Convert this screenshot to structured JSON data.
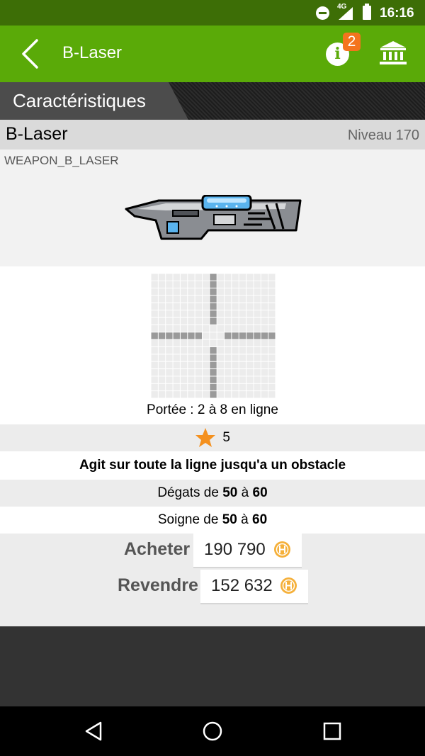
{
  "status_bar": {
    "network": "4G",
    "time": "16:16",
    "icons": [
      "do-not-disturb-icon",
      "signal-icon",
      "battery-icon"
    ]
  },
  "app_bar": {
    "title": "B-Laser",
    "notification_count": "2",
    "icons": [
      "back-arrow-icon",
      "info-icon",
      "bank-icon"
    ]
  },
  "section": {
    "title": "Caractéristiques"
  },
  "item": {
    "name": "B-Laser",
    "level": "Niveau 170",
    "code": "WEAPON_B_LASER",
    "range_text": "Portée : 2 à 8 en ligne",
    "cost": "5",
    "effect": "Agit sur toute la ligne jusqu'a un obstacle",
    "damage": {
      "prefix": "Dégats de",
      "min": "50",
      "sep": "à",
      "max": "60"
    },
    "heal": {
      "prefix": "Soigne de",
      "min": "50",
      "sep": "à",
      "max": "60"
    }
  },
  "prices": {
    "buy_label": "Acheter",
    "buy_amount": "190 790",
    "sell_label": "Revendre",
    "sell_amount": "152 632"
  },
  "range_grid": {
    "size": 17,
    "center": 8,
    "min_range": 2,
    "max_range": 8
  },
  "colors": {
    "status_bar": "#3d6e06",
    "app_bar": "#5aaa08",
    "badge": "#f4741d",
    "star": "#f4901e",
    "coin": "#f5b03a",
    "range_cell": "#9a9a9a",
    "empty_cell": "#ececec"
  },
  "nav_bar": {
    "icons": [
      "back-triangle-icon",
      "home-circle-icon",
      "recents-square-icon"
    ]
  }
}
